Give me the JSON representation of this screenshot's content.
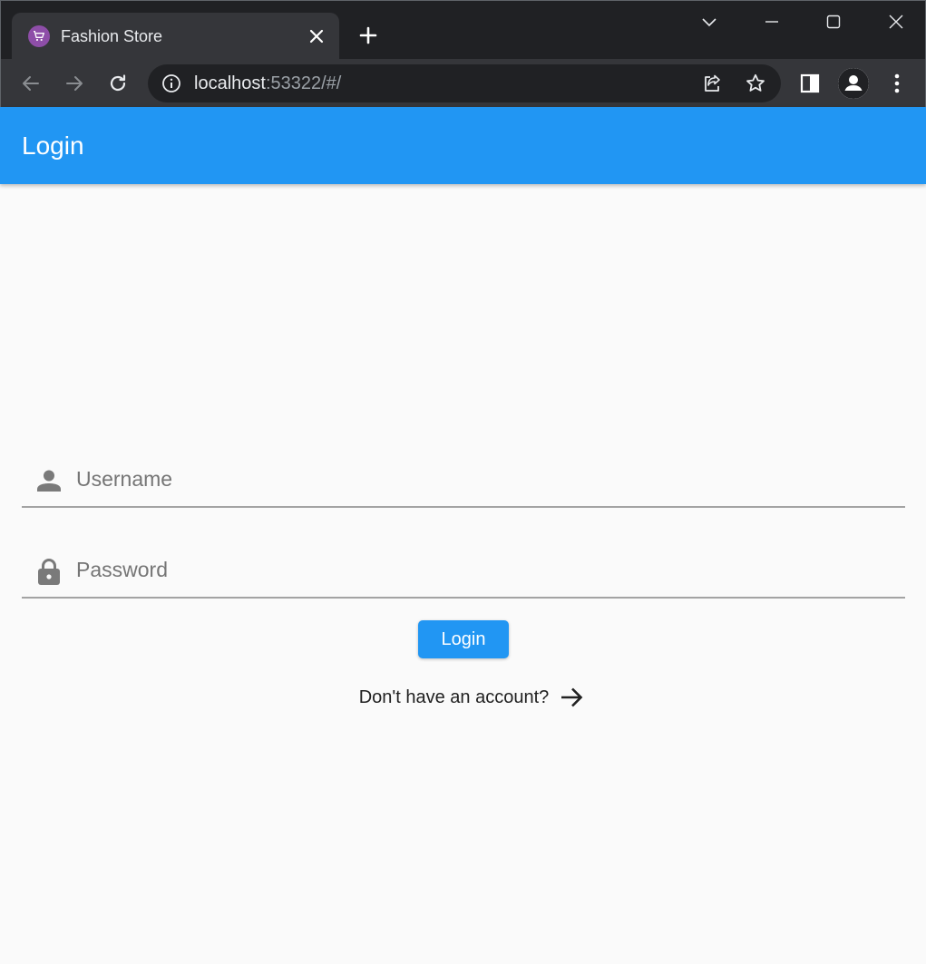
{
  "browser": {
    "tab_title": "Fashion Store",
    "url_host": "localhost",
    "url_rest": ":53322/#/"
  },
  "appbar": {
    "title": "Login"
  },
  "form": {
    "username_placeholder": "Username",
    "username_value": "",
    "password_placeholder": "Password",
    "password_value": "",
    "login_label": "Login",
    "signup_prompt": "Don't have an account?"
  },
  "colors": {
    "primary": "#2196f3",
    "background": "#fafafa",
    "chrome_dark": "#202124",
    "chrome_toolbar": "#35363a",
    "favicon": "#8e4ea8"
  },
  "icons": {
    "username": "person-icon",
    "password": "lock-icon",
    "signup": "arrow-forward-icon"
  }
}
